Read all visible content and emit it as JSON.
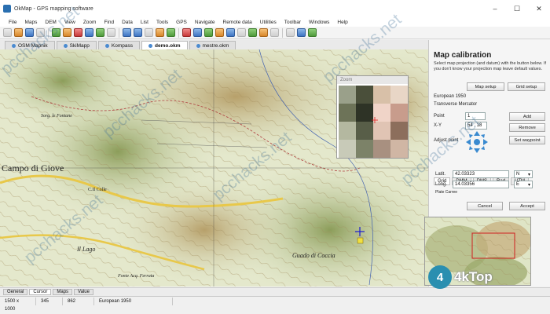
{
  "window": {
    "title": "OkMap - GPS mapping software",
    "buttons": [
      "–",
      "☐",
      "✕"
    ]
  },
  "menu": [
    "File",
    "Maps",
    "DEM",
    "View",
    "Zoom",
    "Find",
    "Data",
    "List",
    "Tools",
    "GPS",
    "Navigate",
    "Remote data",
    "Utilities",
    "Toolbar",
    "Windows",
    "Help"
  ],
  "toolbar_icons": [
    "new-icon",
    "open-icon",
    "save-icon",
    "print-icon",
    "edit-icon",
    "pencil-icon",
    "track-icon",
    "route-icon",
    "waypoint-icon",
    "ruler-icon",
    "zoom-in-icon",
    "zoom-out-icon",
    "zoom-fit-icon",
    "pan-icon",
    "layers-icon",
    "gps-icon",
    "satellite-icon",
    "download-icon",
    "upload-icon",
    "cloud-icon",
    "sync-icon",
    "filter-icon",
    "chart-icon",
    "settings-icon",
    "pointer-icon",
    "crosshair-icon",
    "calibrate-icon"
  ],
  "map_tabs": [
    {
      "label": "OSM Mapnik",
      "active": false
    },
    {
      "label": "SkiMapp",
      "active": false
    },
    {
      "label": "Kompass",
      "active": false
    },
    {
      "label": "demo.okm",
      "active": true
    },
    {
      "label": "mestre.okm",
      "active": false
    }
  ],
  "map_labels": {
    "campo": "Campo di Giove",
    "lago": "Il Lago",
    "guado": "Guado di Coccia",
    "fonte": "Fonte Acq. Ferrata",
    "colle": "C.Il Colle",
    "sorg": "Sorg. le Fontane"
  },
  "zoom_window": {
    "title": "Zoom"
  },
  "panel": {
    "title": "Map calibration",
    "description": "Select map projection (and datum) with the button below. If you don't know your projection map leave default values.",
    "map_setup": "Map setup",
    "grid_setup": "Grid setup",
    "datum": "European 1950",
    "projection": "Transverse Mercator",
    "point_label": "Point",
    "point_value": "1",
    "xy_label": "X-Y",
    "xy_value": "54 ; 18",
    "add": "Add",
    "remove": "Remove",
    "adjust_label": "Adjust point",
    "set_waypoint": "Set waypoint",
    "coord_tabs": [
      "Grid",
      "DMM",
      "DMS",
      "Rad",
      "UTM"
    ],
    "lat_label": "Latit.",
    "lat_value": "42.03323",
    "lat_dir": "N",
    "lon_label": "Long.",
    "lon_value": "14.03356",
    "lon_dir": "E",
    "plate_carree": "Plate Carree",
    "cancel": "Cancel",
    "accept": "Accept"
  },
  "bottom_tabs": [
    "General",
    "Cursor",
    "Maps",
    "Value"
  ],
  "status": [
    "1500 x 1000",
    "345",
    "862",
    "European 1950"
  ],
  "watermark": "pcchacks.net",
  "logo": {
    "letter": "4",
    "text": "4kTop"
  },
  "colors": {
    "accent": "#2a6fb0",
    "map_bg": "#dfe5c6",
    "panel_bg": "#f5f5f5"
  }
}
